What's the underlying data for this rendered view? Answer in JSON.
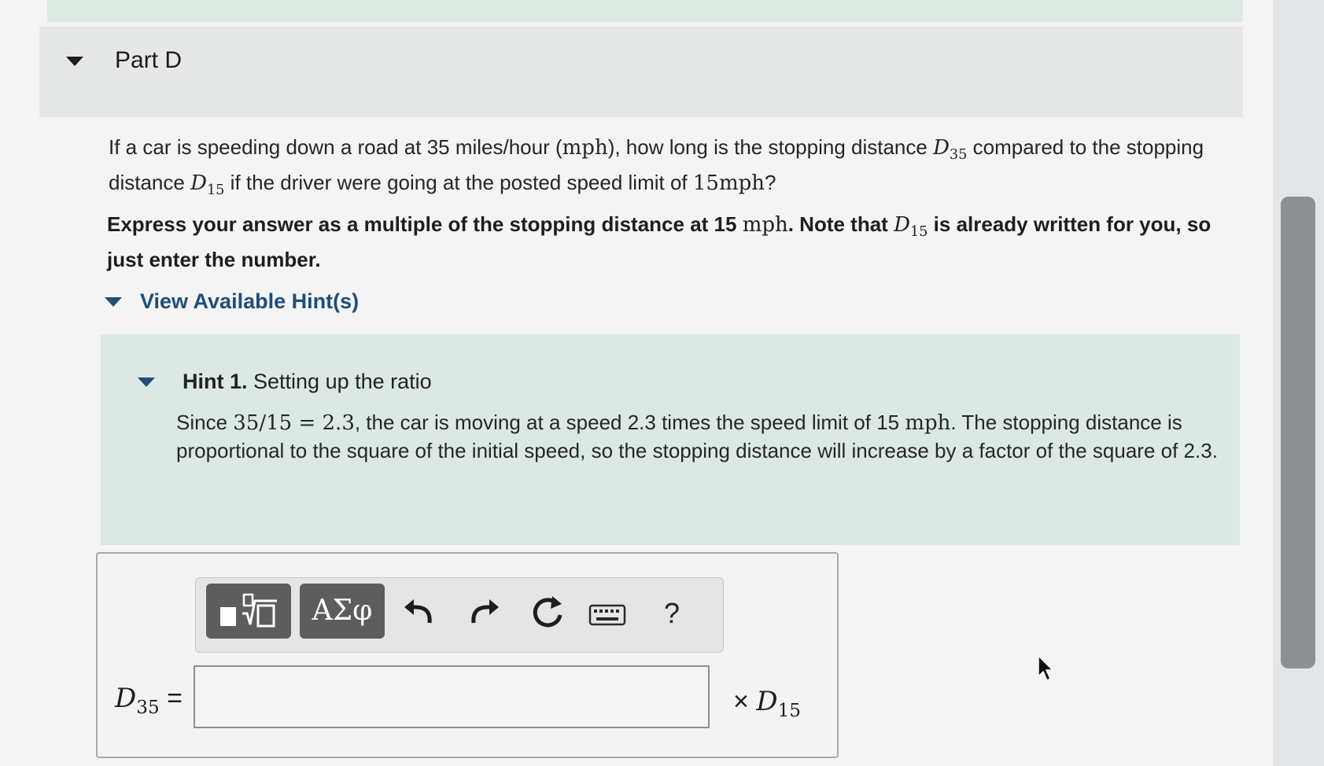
{
  "part": {
    "title": "Part D"
  },
  "question": {
    "t1": "If a car is speeding down a road at 35 miles/hour (",
    "mph_unit": "mph",
    "t2": "), how long is the stopping distance ",
    "d_sym": "D",
    "d35_sub": "35",
    "t3": " compared to the stopping distance ",
    "d15_sub": "15",
    "t4": " if the driver were going at the posted speed limit of ",
    "speed_value": "15mph",
    "t5": "?"
  },
  "instruction": {
    "t1": "Express your answer as a multiple of the stopping distance at 15 ",
    "unit": "mph",
    "t2": ". Note that ",
    "d_sym": "D",
    "d_sub": "15",
    "t3": " is already written for you, so just enter the number."
  },
  "hints": {
    "toggle_label": "View Available Hint(s)",
    "hint1_label": "Hint 1.",
    "hint1_title": " Setting up the ratio",
    "hint1_pre": "Since ",
    "hint1_eq": "35/15 = 2.3",
    "hint1_mid": ", the car is moving at a speed 2.3 times the speed limit of 15 ",
    "hint1_unit": "mph",
    "hint1_post": ". The stopping distance is proportional to the square of the initial speed, so the stopping distance will increase by a factor of the square of 2.3."
  },
  "toolbar": {
    "greek_label": "ΑΣφ",
    "help_label": "?",
    "icons": [
      "templates-icon",
      "undo-icon",
      "redo-icon",
      "reset-icon",
      "keyboard-icon",
      "help-icon"
    ]
  },
  "answer": {
    "lhs_symbol": "D",
    "lhs_sub": "35",
    "equals": "=",
    "value": "",
    "times": "×",
    "rhs_symbol": "D",
    "rhs_sub": "15"
  }
}
